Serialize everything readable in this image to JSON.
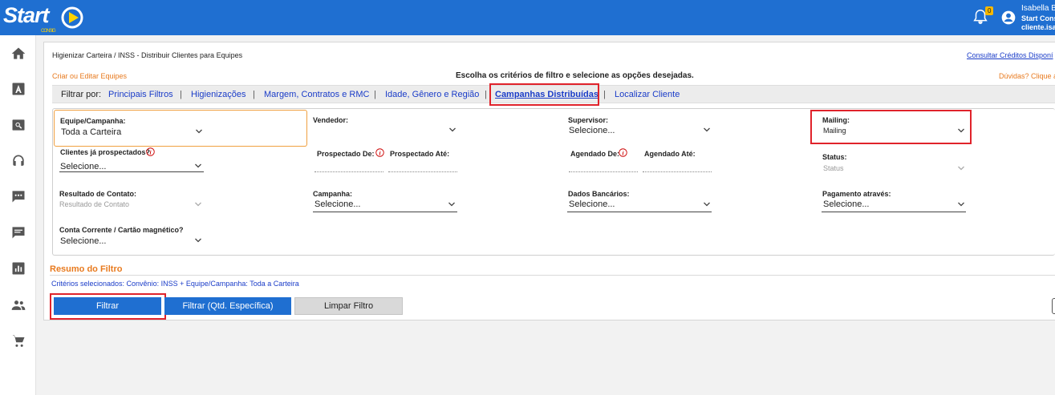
{
  "header": {
    "logo_text": "Start",
    "logo_sub": "CONSIG",
    "notification_count": "0",
    "user_name": "Isabella B",
    "user_company": "Start Cons",
    "user_email": "cliente.isa"
  },
  "sidebar": {
    "icons": [
      "home-icon",
      "text-icon",
      "search-icon",
      "headset-icon",
      "chat-icon",
      "message-icon",
      "chart-icon",
      "people-icon",
      "cart-icon"
    ]
  },
  "page": {
    "breadcrumb": "Higienizar Carteira / INSS - Distribuir Clientes para Equipes",
    "credit_link": "Consultar Créditos Disponí",
    "edit_link": "Criar ou Editar Equipes",
    "instructions": "Escolha os critérios de filtro e selecione as opções desejadas.",
    "doubt_link": "Dúvidas? Clique a"
  },
  "filter_bar": {
    "label": "Filtrar por:",
    "tabs": [
      "Principais Filtros",
      "Higienizações",
      "Margem, Contratos e RMC",
      "Idade, Gênero e Região",
      "Campanhas Distribuídas",
      "Localizar Cliente"
    ],
    "separator": "|"
  },
  "form": {
    "equipe": {
      "label": "Equipe/Campanha:",
      "value": "Toda a Carteira"
    },
    "vendedor": {
      "label": "Vendedor:",
      "value": ""
    },
    "supervisor": {
      "label": "Supervisor:",
      "value": "Selecione..."
    },
    "mailing": {
      "label": "Mailing:",
      "value": "Mailing"
    },
    "prospectados": {
      "label": "Clientes já prospectados?",
      "value": "Selecione..."
    },
    "prospectado_de": {
      "label": "Prospectado De:"
    },
    "prospectado_ate": {
      "label": "Prospectado Até:"
    },
    "agendado_de": {
      "label": "Agendado De:"
    },
    "agendado_ate": {
      "label": "Agendado Até:"
    },
    "status": {
      "label": "Status:",
      "value": "Status"
    },
    "resultado": {
      "label": "Resultado de Contato:",
      "value": "Resultado de Contato"
    },
    "campanha": {
      "label": "Campanha:",
      "value": "Selecione..."
    },
    "dados_bancarios": {
      "label": "Dados Bancários:",
      "value": "Selecione..."
    },
    "pagamento": {
      "label": "Pagamento através:",
      "value": "Selecione..."
    },
    "conta": {
      "label": "Conta Corrente / Cartão magnético?",
      "value": "Selecione..."
    }
  },
  "summary": {
    "title": "Resumo do Filtro",
    "criteria": "Critérios selecionados: Convênio: INSS + Equipe/Campanha: Toda a Carteira"
  },
  "buttons": {
    "filter": "Filtrar",
    "filter_qty": "Filtrar (Qtd. Específica)",
    "clear": "Limpar Filtro"
  },
  "colors": {
    "brand_blue": "#1f6fd1",
    "accent_orange": "#e87a1e",
    "highlight_red": "#e0232b",
    "link_blue": "#1a3cc8"
  }
}
